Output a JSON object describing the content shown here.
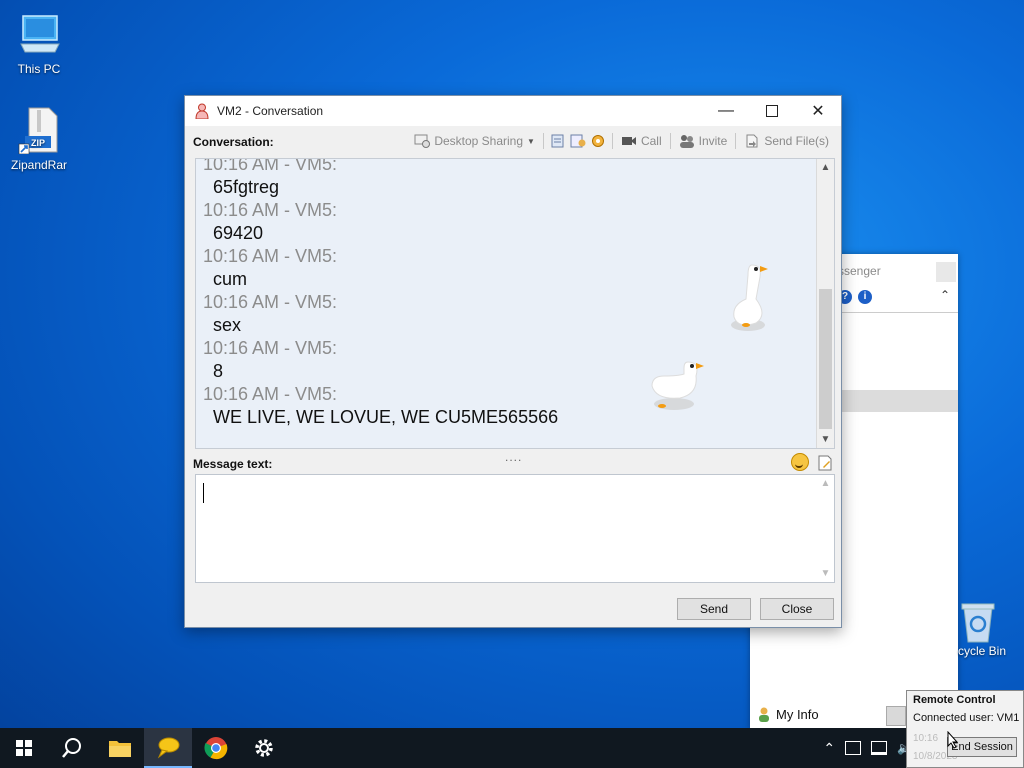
{
  "desktop": {
    "icons": [
      {
        "label": "This PC"
      },
      {
        "label": "ZipandRar"
      }
    ],
    "recycle_label": "cycle Bin"
  },
  "bg_window": {
    "title_fragment": "ssenger",
    "my_info": "My Info"
  },
  "window": {
    "title": "VM2 - Conversation",
    "conversation_label": "Conversation:",
    "toolbar": {
      "desktop_sharing": "Desktop Sharing",
      "call": "Call",
      "invite": "Invite",
      "send_files": "Send File(s)"
    },
    "messages": [
      {
        "meta": "10:16 AM - VM5:",
        "text": "65fgtreg"
      },
      {
        "meta": "10:16 AM - VM5:",
        "text": "69420"
      },
      {
        "meta": "10:16 AM - VM5:",
        "text": "cum"
      },
      {
        "meta": "10:16 AM - VM5:",
        "text": "sex"
      },
      {
        "meta": "10:16 AM - VM5:",
        "text": "8"
      },
      {
        "meta": "10:16 AM - VM5:",
        "text": "WE LIVE, WE LOVUE, WE CU5ME565566"
      }
    ],
    "message_text_label": "Message text:",
    "send_label": "Send",
    "close_label": "Close"
  },
  "popup": {
    "title": "Remote Control",
    "connected": "Connected user: VM1",
    "time_ghost": "10:16",
    "date_ghost": "10/8/2023",
    "end_session": "End Session"
  }
}
